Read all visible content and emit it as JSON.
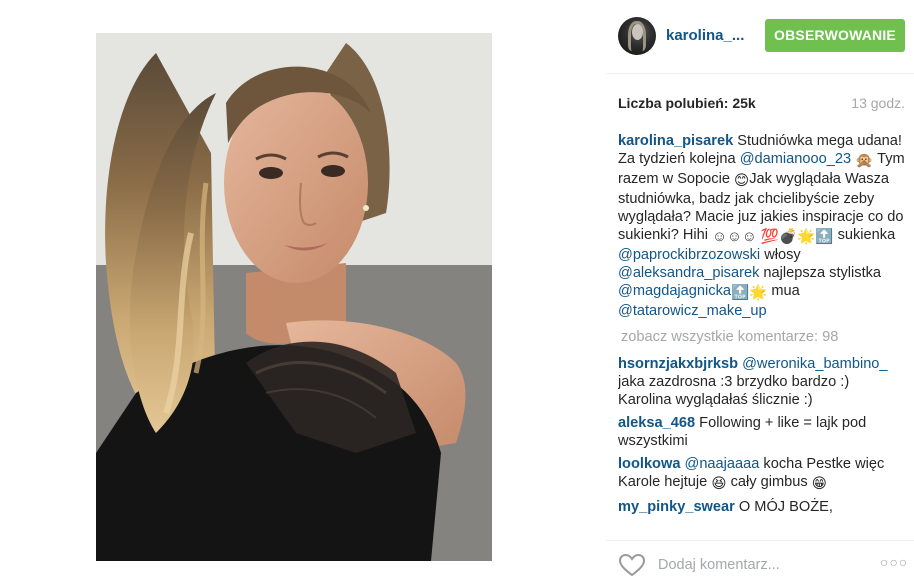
{
  "post": {
    "image_alt": "selfie of a young woman with long blonde hair in a black one-shoulder lace dress",
    "username_short": "karolina_...",
    "follow_label": "OBSERWOWANIE",
    "likes": "Liczba polubień: 25k",
    "time_ago": "13 godz."
  },
  "caption": {
    "user": "karolina_pisarek",
    "t1": " Studniówka mega udana! Za tydzień kolejna ",
    "m1": "@damianooo_23",
    "e1": "🙊",
    "t2": " Tym razem w Sopocie ",
    "e2": "😊",
    "t3": "Jak wyglądała Wasza studniówka, badz jak chcielibyście zeby wyglądała? Macie juz jakies inspiracje co do sukienki? Hihi ",
    "e3": "☺☺☺ 💯💣🌟🔝",
    "t4": " sukienka ",
    "m2": "@paprockibrzozowski",
    "t5": " włosy ",
    "m3": "@aleksandra_pisarek",
    "t6": " najlepsza stylistka ",
    "m4": "@magdajagnicka",
    "e4": " 🔝🌟",
    "t7": " mua ",
    "m5": "@tatarowicz_make_up"
  },
  "view_all_comments": "zobacz wszystkie komentarze: 98",
  "comments": [
    {
      "user": "hsornzjakxbjrksb",
      "mention": "@weronika_bambino_",
      "text": " jaka zazdrosna :3 brzydko bardzo :) Karolina wyglądałaś ślicznie :)"
    },
    {
      "user": "aleksa_468",
      "text": " Following + like = lajk pod wszystkimi"
    },
    {
      "user": "loolkowa",
      "mention": "@naajaaaa",
      "text": " kocha Pestke więc Karole hejtuje ",
      "emoji": "😆",
      "text2": " cały gimbus ",
      "emoji2": "😁"
    },
    {
      "user": "my_pinky_swear",
      "text": " O MÓJ BOŻE,"
    }
  ],
  "footer": {
    "add_comment_placeholder": "Dodaj komentarz...",
    "more_label": "○○○",
    "heart_icon": "heart-outline-icon"
  },
  "colors": {
    "link_blue": "#125688",
    "follow_green": "#70c050",
    "muted_gray": "#a5a7aa"
  }
}
